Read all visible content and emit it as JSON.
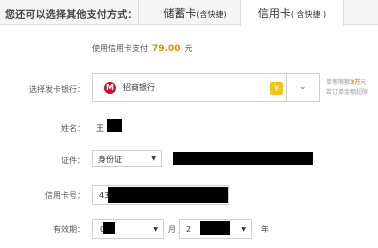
{
  "tabs_bar": {
    "prompt": "您还可以选择其他支付方式：",
    "debit_tab": {
      "label": "储蓄卡",
      "hint": "(含快捷)"
    },
    "credit_tab": {
      "label": "信用卡",
      "hint": "( 含快捷 )"
    }
  },
  "amount_line": {
    "prefix": "使用信用卡支付",
    "amount": "79.00",
    "currency": "元"
  },
  "form": {
    "bank": {
      "label": "选择发卡银行：",
      "logo_glyph": "M",
      "value": "招商银行",
      "badge_glyph": "¥",
      "arrow_glyph": "⌄",
      "note_prefix": "单笔限额",
      "note_limit": "3万",
      "note_unit": "元",
      "note_line2": "若订单金额超限"
    },
    "name": {
      "label": "姓名：",
      "value_prefix": "王"
    },
    "id": {
      "label": "证件：",
      "type_value": "身份证",
      "caret": "▼"
    },
    "card_number": {
      "label": "信用卡号：",
      "value_prefix": "43"
    },
    "expiry": {
      "label": "有效期：",
      "month_value": "0",
      "month_sep": "月 /",
      "year_value": "2",
      "year_unit": "年",
      "caret": "▼"
    }
  },
  "colors": {
    "accent": "#e08a00",
    "bank_logo": "#c8102e",
    "badge": "#f7c21a",
    "border": "#cfcfcf"
  }
}
